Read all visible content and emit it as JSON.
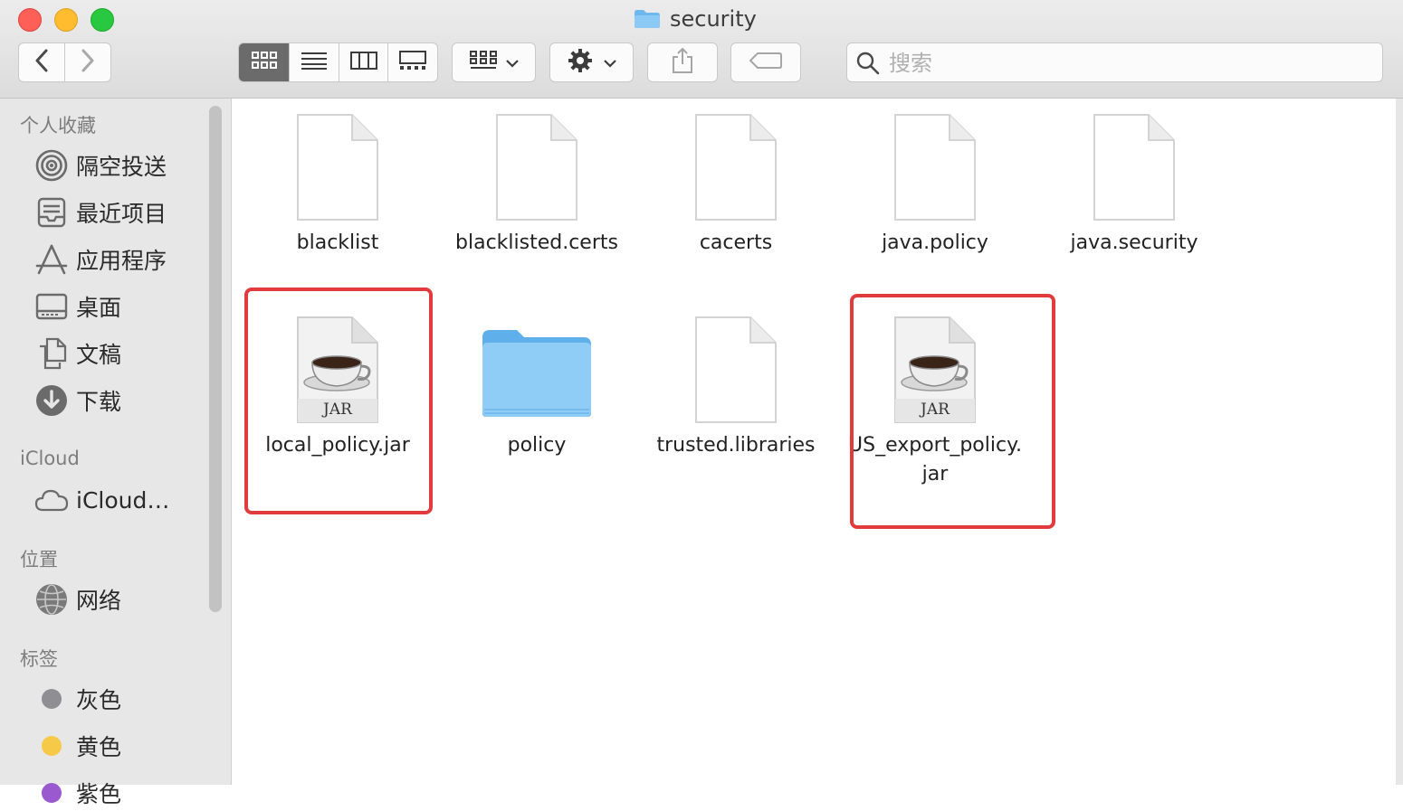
{
  "window": {
    "title": "security",
    "title_icon": "folder-icon"
  },
  "toolbar": {
    "back_icon": "chevron-left-icon",
    "forward_icon": "chevron-right-icon",
    "view_modes": [
      "icon-view-icon",
      "list-view-icon",
      "column-view-icon",
      "gallery-view-icon"
    ],
    "active_view": "icon-view-icon",
    "group_icon": "group-by-icon",
    "action_icon": "gear-icon",
    "share_icon": "share-icon",
    "tag_icon": "tag-icon",
    "search_placeholder": "搜索"
  },
  "sidebar": {
    "favorites_header": "个人收藏",
    "favorites": [
      {
        "label": "隔空投送",
        "icon": "airdrop-icon"
      },
      {
        "label": "最近项目",
        "icon": "recents-icon"
      },
      {
        "label": "应用程序",
        "icon": "applications-icon"
      },
      {
        "label": "桌面",
        "icon": "desktop-icon"
      },
      {
        "label": "文稿",
        "icon": "documents-icon"
      },
      {
        "label": "下载",
        "icon": "downloads-icon"
      }
    ],
    "icloud_header": "iCloud",
    "icloud": [
      {
        "label": "iCloud…",
        "icon": "cloud-icon"
      }
    ],
    "locations_header": "位置",
    "locations": [
      {
        "label": "网络",
        "icon": "network-icon"
      }
    ],
    "tags_header": "标签",
    "tags": [
      {
        "label": "灰色",
        "color": "#8e8e93"
      },
      {
        "label": "黄色",
        "color": "#f7c948"
      },
      {
        "label": "紫色",
        "color": "#9b59d0"
      }
    ]
  },
  "files": [
    {
      "name": "blacklist",
      "type": "document"
    },
    {
      "name": "blacklisted.certs",
      "type": "document"
    },
    {
      "name": "cacerts",
      "type": "document"
    },
    {
      "name": "java.policy",
      "type": "document"
    },
    {
      "name": "java.security",
      "type": "document"
    },
    {
      "name": "local_policy.jar",
      "type": "jar",
      "badge": "JAR",
      "highlighted": true
    },
    {
      "name": "policy",
      "type": "folder"
    },
    {
      "name": "trusted.libraries",
      "type": "document"
    },
    {
      "name_line1": "US_export_policy.",
      "name_line2": "jar",
      "type": "jar",
      "badge": "JAR",
      "highlighted": true
    }
  ],
  "colors": {
    "highlight": "#e23b3e",
    "folder": "#74c0f2",
    "sidebar_bg": "#e7e7e7"
  }
}
